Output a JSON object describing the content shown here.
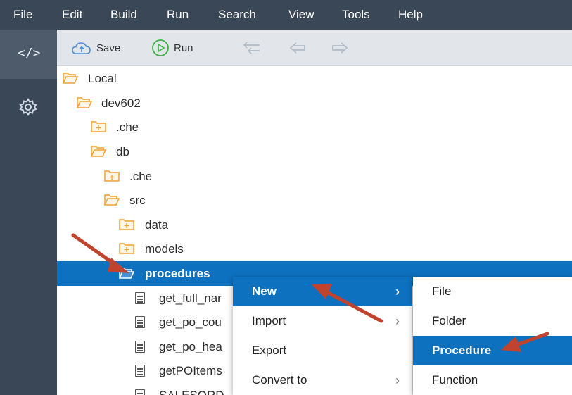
{
  "menubar": {
    "items": [
      "File",
      "Edit",
      "Build",
      "Run",
      "Search",
      "View",
      "Tools",
      "Help"
    ]
  },
  "sidebar": {
    "items": [
      {
        "icon": "code-icon",
        "label": "</>",
        "active": true
      },
      {
        "icon": "gear-icon",
        "active": false
      }
    ]
  },
  "toolbar": {
    "save_label": "Save",
    "run_label": "Run",
    "nav": [
      "collapse-all-icon",
      "back-icon",
      "forward-icon"
    ]
  },
  "tree": {
    "rows": [
      {
        "label": "Local",
        "type": "folder-open"
      },
      {
        "label": "dev602",
        "type": "folder-open"
      },
      {
        "label": ".che",
        "type": "folder-closed"
      },
      {
        "label": "db",
        "type": "folder-open"
      },
      {
        "label": ".che",
        "type": "folder-closed"
      },
      {
        "label": "src",
        "type": "folder-open"
      },
      {
        "label": "data",
        "type": "folder-closed"
      },
      {
        "label": "models",
        "type": "folder-closed"
      },
      {
        "label": "procedures",
        "type": "folder-open",
        "selected": true
      },
      {
        "label": "get_full_nar",
        "type": "file"
      },
      {
        "label": "get_po_cou",
        "type": "file"
      },
      {
        "label": "get_po_hea",
        "type": "file"
      },
      {
        "label": "getPOItems",
        "type": "file"
      },
      {
        "label": "SALESORD",
        "type": "file"
      }
    ]
  },
  "context_menu": {
    "items": [
      {
        "label": "New",
        "submenu": true,
        "highlighted": true,
        "chevron": "›"
      },
      {
        "label": "Import",
        "submenu": true,
        "chevron": "›"
      },
      {
        "label": "Export",
        "submenu": false
      },
      {
        "label": "Convert to",
        "submenu": true,
        "chevron": "›"
      }
    ]
  },
  "submenu": {
    "items": [
      {
        "label": "File"
      },
      {
        "label": "Folder"
      },
      {
        "label": "Procedure",
        "highlighted": true
      },
      {
        "label": "Function"
      }
    ]
  },
  "colors": {
    "menubar_bg": "#3a4756",
    "selection": "#0e71bf",
    "folder": "#f0a030",
    "annotation_arrow": "#c0432d"
  }
}
